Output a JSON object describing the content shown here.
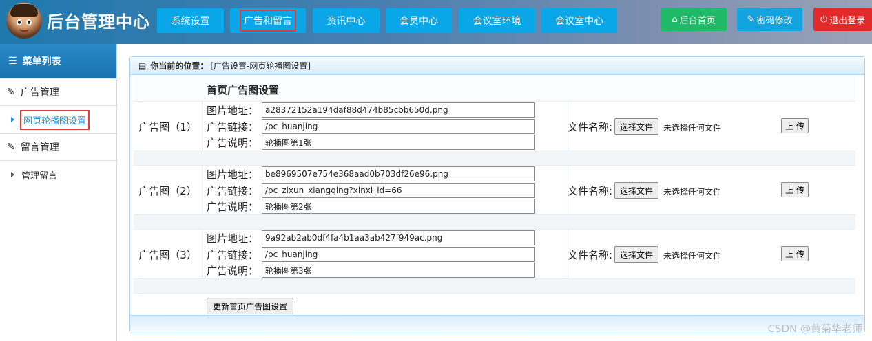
{
  "brand": {
    "title": "后台管理中心"
  },
  "nav": [
    {
      "label": "系统设置"
    },
    {
      "label": "广告和留言"
    },
    {
      "label": "资讯中心"
    },
    {
      "label": "会员中心"
    },
    {
      "label": "会议室环境"
    },
    {
      "label": "会议室中心"
    }
  ],
  "top_actions": {
    "home": {
      "label": "后台首页",
      "icon": "home-icon"
    },
    "password": {
      "label": "密码修改",
      "icon": "wrench-icon"
    },
    "logout": {
      "label": "退出登录",
      "icon": "power-icon"
    }
  },
  "sidebar": {
    "title": "菜单列表",
    "groups": [
      {
        "label": "广告管理",
        "items": [
          {
            "label": "网页轮播图设置"
          }
        ]
      },
      {
        "label": "留言管理",
        "items": [
          {
            "label": "管理留言"
          }
        ]
      }
    ]
  },
  "breadcrumb": {
    "label": "你当前的位置：",
    "value": "[广告设置-网页轮播图设置]"
  },
  "form": {
    "title": "首页广告图设置",
    "labels": {
      "image": "图片地址：",
      "link": "广告链接：",
      "desc": "广告说明：",
      "file_name": "文件名称:"
    },
    "choose_file": "选择文件",
    "no_file": "未选择任何文件",
    "upload": "上 传",
    "submit": "更新首页广告图设置",
    "ads": [
      {
        "name": "广告图（1）",
        "image": "a28372152a194daf88d474b85cbb650d.png",
        "link": "/pc_huanjing",
        "desc": "轮播图第1张"
      },
      {
        "name": "广告图（2）",
        "image": "be8969507e754e368aad0b703df26e96.png",
        "link": "/pc_zixun_xiangqing?xinxi_id=66",
        "desc": "轮播图第2张"
      },
      {
        "name": "广告图（3）",
        "image": "9a92ab2ab0df4fa4b1aa3ab427f949ac.png",
        "link": "/pc_huanjing",
        "desc": "轮播图第3张"
      }
    ]
  },
  "watermark": "CSDN @黄菊华老师"
}
